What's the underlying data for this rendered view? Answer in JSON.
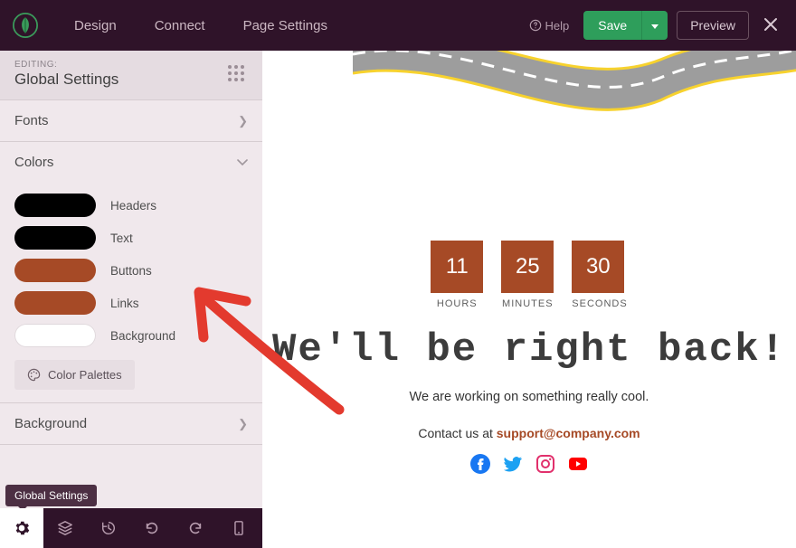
{
  "topbar": {
    "nav": {
      "design": "Design",
      "connect": "Connect",
      "settings": "Page Settings"
    },
    "help": "Help",
    "save": "Save",
    "preview": "Preview"
  },
  "sidebar": {
    "editing_label": "EDITING:",
    "title": "Global Settings",
    "panels": {
      "fonts": "Fonts",
      "colors": "Colors",
      "background": "Background"
    },
    "colors": [
      {
        "label": "Headers",
        "value": "#000000"
      },
      {
        "label": "Text",
        "value": "#000000"
      },
      {
        "label": "Buttons",
        "value": "#a64a26"
      },
      {
        "label": "Links",
        "value": "#a64a26"
      },
      {
        "label": "Background",
        "value": "#ffffff"
      }
    ],
    "palettes_btn": "Color Palettes",
    "tooltip": "Global Settings"
  },
  "canvas": {
    "countdown": [
      {
        "value": "11",
        "label": "HOURS"
      },
      {
        "value": "25",
        "label": "MINUTES"
      },
      {
        "value": "30",
        "label": "SECONDS"
      }
    ],
    "headline": "We'll be right back!",
    "subtext": "We are working on something really cool.",
    "contact_prefix": "Contact us at ",
    "contact_email": "support@company.com",
    "social": {
      "facebook": "facebook-icon",
      "twitter": "twitter-icon",
      "instagram": "instagram-icon",
      "youtube": "youtube-icon"
    }
  },
  "brand_colors": {
    "accent": "#a64a26",
    "green": "#2e9e5b",
    "annotation": "#e33a2e"
  }
}
